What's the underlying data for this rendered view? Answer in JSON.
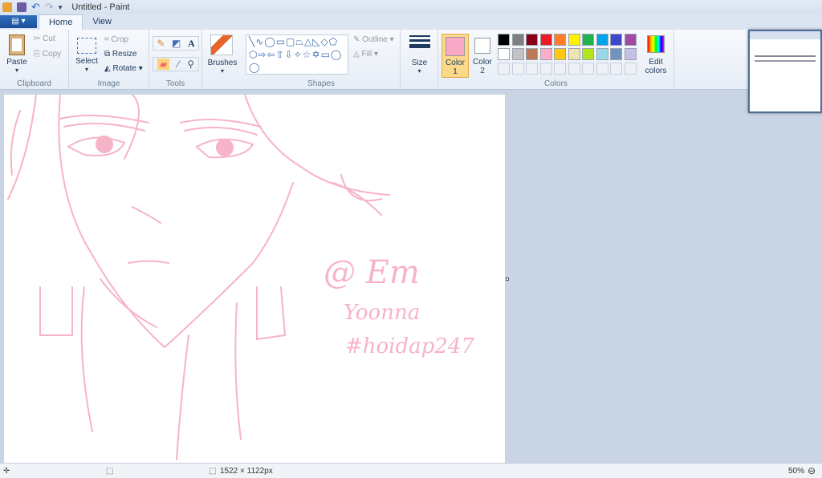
{
  "title": "Untitled - Paint",
  "tabs": {
    "file": "▤ ▾",
    "home": "Home",
    "view": "View"
  },
  "clipboard": {
    "paste": "Paste",
    "cut": "Cut",
    "copy": "Copy",
    "label": "Clipboard"
  },
  "image": {
    "select": "Select",
    "crop": "Crop",
    "resize": "Resize",
    "rotate": "Rotate",
    "label": "Image"
  },
  "tools": {
    "label": "Tools"
  },
  "brushes": {
    "label": "Brushes"
  },
  "shapes": {
    "outline": "Outline",
    "fill": "Fill",
    "label": "Shapes",
    "glyphs": "╲∿◯▭▢⏢△◺◇⬠⬡⇨⇦⇧⇩✧☆✡▭◯◯"
  },
  "size": {
    "label": "Size"
  },
  "colors": {
    "color1_line1": "Color",
    "color1_line2": "1",
    "color2_line1": "Color",
    "color2_line2": "2",
    "edit_line1": "Edit",
    "edit_line2": "colors",
    "label": "Colors",
    "color1": "#f9a8c6",
    "color2": "#ffffff",
    "palette": [
      "#000000",
      "#7f7f7f",
      "#880015",
      "#ed1c24",
      "#ff7f27",
      "#fff200",
      "#22b14c",
      "#00a2e8",
      "#3f48cc",
      "#a349a4",
      "#ffffff",
      "#c3c3c3",
      "#b97a57",
      "#ffaec9",
      "#ffc90e",
      "#efe4b0",
      "#b5e61d",
      "#99d9ea",
      "#7092be",
      "#c8bfe7"
    ]
  },
  "drawing": {
    "signature": "@ Em",
    "name": "Yoonna",
    "tag": "#hoidap247",
    "ink": "#f7b3c7"
  },
  "status": {
    "dimensions": "1522 × 1122px",
    "zoom": "50%"
  }
}
